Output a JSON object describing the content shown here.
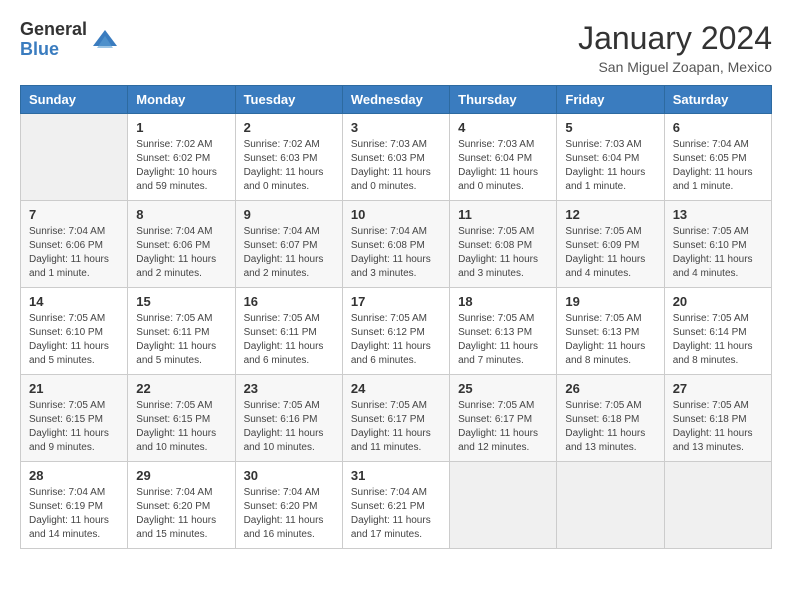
{
  "logo": {
    "general": "General",
    "blue": "Blue"
  },
  "title": {
    "month": "January 2024",
    "location": "San Miguel Zoapan, Mexico"
  },
  "days_of_week": [
    "Sunday",
    "Monday",
    "Tuesday",
    "Wednesday",
    "Thursday",
    "Friday",
    "Saturday"
  ],
  "weeks": [
    [
      {
        "day": "",
        "info": ""
      },
      {
        "day": "1",
        "info": "Sunrise: 7:02 AM\nSunset: 6:02 PM\nDaylight: 10 hours\nand 59 minutes."
      },
      {
        "day": "2",
        "info": "Sunrise: 7:02 AM\nSunset: 6:03 PM\nDaylight: 11 hours\nand 0 minutes."
      },
      {
        "day": "3",
        "info": "Sunrise: 7:03 AM\nSunset: 6:03 PM\nDaylight: 11 hours\nand 0 minutes."
      },
      {
        "day": "4",
        "info": "Sunrise: 7:03 AM\nSunset: 6:04 PM\nDaylight: 11 hours\nand 0 minutes."
      },
      {
        "day": "5",
        "info": "Sunrise: 7:03 AM\nSunset: 6:04 PM\nDaylight: 11 hours\nand 1 minute."
      },
      {
        "day": "6",
        "info": "Sunrise: 7:04 AM\nSunset: 6:05 PM\nDaylight: 11 hours\nand 1 minute."
      }
    ],
    [
      {
        "day": "7",
        "info": "Sunrise: 7:04 AM\nSunset: 6:06 PM\nDaylight: 11 hours\nand 1 minute."
      },
      {
        "day": "8",
        "info": "Sunrise: 7:04 AM\nSunset: 6:06 PM\nDaylight: 11 hours\nand 2 minutes."
      },
      {
        "day": "9",
        "info": "Sunrise: 7:04 AM\nSunset: 6:07 PM\nDaylight: 11 hours\nand 2 minutes."
      },
      {
        "day": "10",
        "info": "Sunrise: 7:04 AM\nSunset: 6:08 PM\nDaylight: 11 hours\nand 3 minutes."
      },
      {
        "day": "11",
        "info": "Sunrise: 7:05 AM\nSunset: 6:08 PM\nDaylight: 11 hours\nand 3 minutes."
      },
      {
        "day": "12",
        "info": "Sunrise: 7:05 AM\nSunset: 6:09 PM\nDaylight: 11 hours\nand 4 minutes."
      },
      {
        "day": "13",
        "info": "Sunrise: 7:05 AM\nSunset: 6:10 PM\nDaylight: 11 hours\nand 4 minutes."
      }
    ],
    [
      {
        "day": "14",
        "info": "Sunrise: 7:05 AM\nSunset: 6:10 PM\nDaylight: 11 hours\nand 5 minutes."
      },
      {
        "day": "15",
        "info": "Sunrise: 7:05 AM\nSunset: 6:11 PM\nDaylight: 11 hours\nand 5 minutes."
      },
      {
        "day": "16",
        "info": "Sunrise: 7:05 AM\nSunset: 6:11 PM\nDaylight: 11 hours\nand 6 minutes."
      },
      {
        "day": "17",
        "info": "Sunrise: 7:05 AM\nSunset: 6:12 PM\nDaylight: 11 hours\nand 6 minutes."
      },
      {
        "day": "18",
        "info": "Sunrise: 7:05 AM\nSunset: 6:13 PM\nDaylight: 11 hours\nand 7 minutes."
      },
      {
        "day": "19",
        "info": "Sunrise: 7:05 AM\nSunset: 6:13 PM\nDaylight: 11 hours\nand 8 minutes."
      },
      {
        "day": "20",
        "info": "Sunrise: 7:05 AM\nSunset: 6:14 PM\nDaylight: 11 hours\nand 8 minutes."
      }
    ],
    [
      {
        "day": "21",
        "info": "Sunrise: 7:05 AM\nSunset: 6:15 PM\nDaylight: 11 hours\nand 9 minutes."
      },
      {
        "day": "22",
        "info": "Sunrise: 7:05 AM\nSunset: 6:15 PM\nDaylight: 11 hours\nand 10 minutes."
      },
      {
        "day": "23",
        "info": "Sunrise: 7:05 AM\nSunset: 6:16 PM\nDaylight: 11 hours\nand 10 minutes."
      },
      {
        "day": "24",
        "info": "Sunrise: 7:05 AM\nSunset: 6:17 PM\nDaylight: 11 hours\nand 11 minutes."
      },
      {
        "day": "25",
        "info": "Sunrise: 7:05 AM\nSunset: 6:17 PM\nDaylight: 11 hours\nand 12 minutes."
      },
      {
        "day": "26",
        "info": "Sunrise: 7:05 AM\nSunset: 6:18 PM\nDaylight: 11 hours\nand 13 minutes."
      },
      {
        "day": "27",
        "info": "Sunrise: 7:05 AM\nSunset: 6:18 PM\nDaylight: 11 hours\nand 13 minutes."
      }
    ],
    [
      {
        "day": "28",
        "info": "Sunrise: 7:04 AM\nSunset: 6:19 PM\nDaylight: 11 hours\nand 14 minutes."
      },
      {
        "day": "29",
        "info": "Sunrise: 7:04 AM\nSunset: 6:20 PM\nDaylight: 11 hours\nand 15 minutes."
      },
      {
        "day": "30",
        "info": "Sunrise: 7:04 AM\nSunset: 6:20 PM\nDaylight: 11 hours\nand 16 minutes."
      },
      {
        "day": "31",
        "info": "Sunrise: 7:04 AM\nSunset: 6:21 PM\nDaylight: 11 hours\nand 17 minutes."
      },
      {
        "day": "",
        "info": ""
      },
      {
        "day": "",
        "info": ""
      },
      {
        "day": "",
        "info": ""
      }
    ]
  ]
}
